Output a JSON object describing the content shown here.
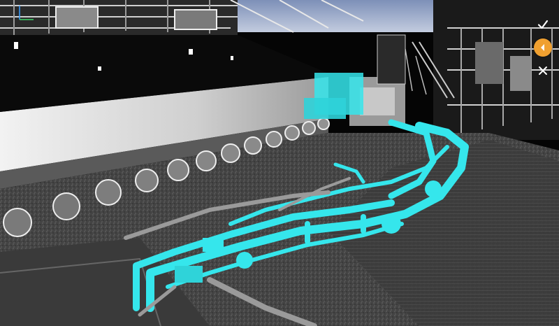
{
  "viewer": {
    "background": "#050505",
    "highlight_color": "#35e6ec",
    "accent_color": "#f0a030",
    "scan_tone": "#b8b8b8"
  },
  "toolbar": {
    "buttons": [
      {
        "icon": "check-icon"
      },
      {
        "icon": "chevron-left-icon"
      },
      {
        "icon": "close-icon"
      }
    ]
  },
  "axis": {
    "x_color": "#3aa0ff",
    "y_color": "#3fd46a"
  }
}
